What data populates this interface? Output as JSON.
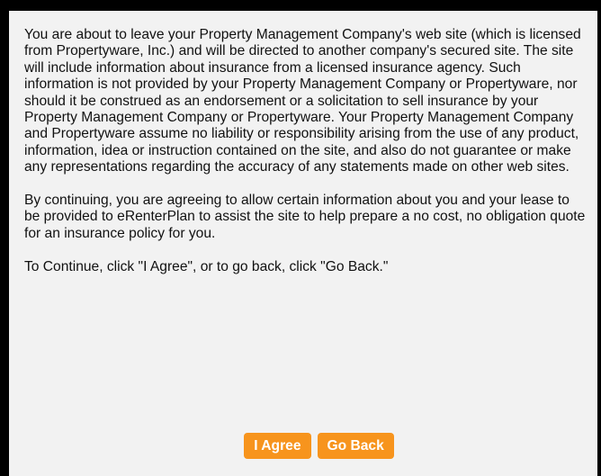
{
  "dialog": {
    "paragraphs": [
      "You are about to leave your Property Management Company's web site (which is licensed from Propertyware, Inc.) and will be directed to another company's secured site. The site will include information about insurance from a licensed insurance agency. Such information is not provided by your Property Management Company or Propertyware, nor should it be construed as an endorsement or a solicitation to sell insurance by your Property Management Company or Propertyware. Your Property Management Company and Propertyware assume no liability or responsibility arising from the use of any product, information, idea or instruction contained on the site, and also do not guarantee or make any representations regarding the accuracy of any statements made on other web sites.",
      "By continuing, you are agreeing to allow certain information about you and your lease to be provided to eRenterPlan to assist the site to help prepare a no cost, no obligation quote for an insurance policy for you.",
      "To Continue, click \"I Agree\", or to go back, click \"Go Back.\""
    ],
    "agree_label": "I Agree",
    "back_label": "Go Back"
  },
  "colors": {
    "background": "#000000",
    "panel": "#f2f2f2",
    "button": "#f7941d",
    "button_text": "#ffffff"
  }
}
